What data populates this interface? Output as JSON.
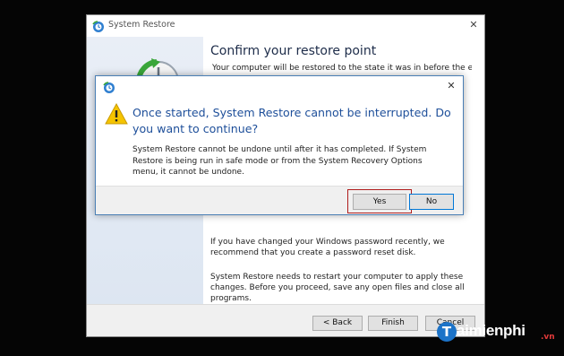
{
  "main_window": {
    "title": "System Restore",
    "close_glyph": "✕",
    "heading": "Confirm your restore point",
    "intro_text": "Your computer will be restored to the state it was in before the event",
    "password_note": "If you have changed your Windows password recently, we recommend that you create a password reset disk.",
    "restart_note": "System Restore needs to restart your computer to apply these changes. Before you proceed, save any open files and close all programs.",
    "buttons": {
      "back": "< Back",
      "finish": "Finish",
      "cancel": "Cancel"
    },
    "icons": {
      "app": "system-restore-icon",
      "graphic": "restore-clock-graphic"
    }
  },
  "dialog": {
    "close_glyph": "✕",
    "heading": "Once started, System Restore cannot be interrupted. Do you want to continue?",
    "body": "System Restore cannot be undone until after it has completed. If System Restore is being run in safe mode or from the System Recovery Options menu, it cannot be undone.",
    "buttons": {
      "yes": "Yes",
      "no": "No"
    },
    "icons": {
      "app": "system-restore-icon",
      "warning": "warning-icon"
    },
    "highlight_color": "#b01c1c"
  },
  "watermark": {
    "letter": "T",
    "text": "aimienphi",
    "tld": ".vn"
  },
  "colors": {
    "heading_blue": "#1e4f9a",
    "focus_blue": "#0078d7",
    "background": "#050505"
  }
}
